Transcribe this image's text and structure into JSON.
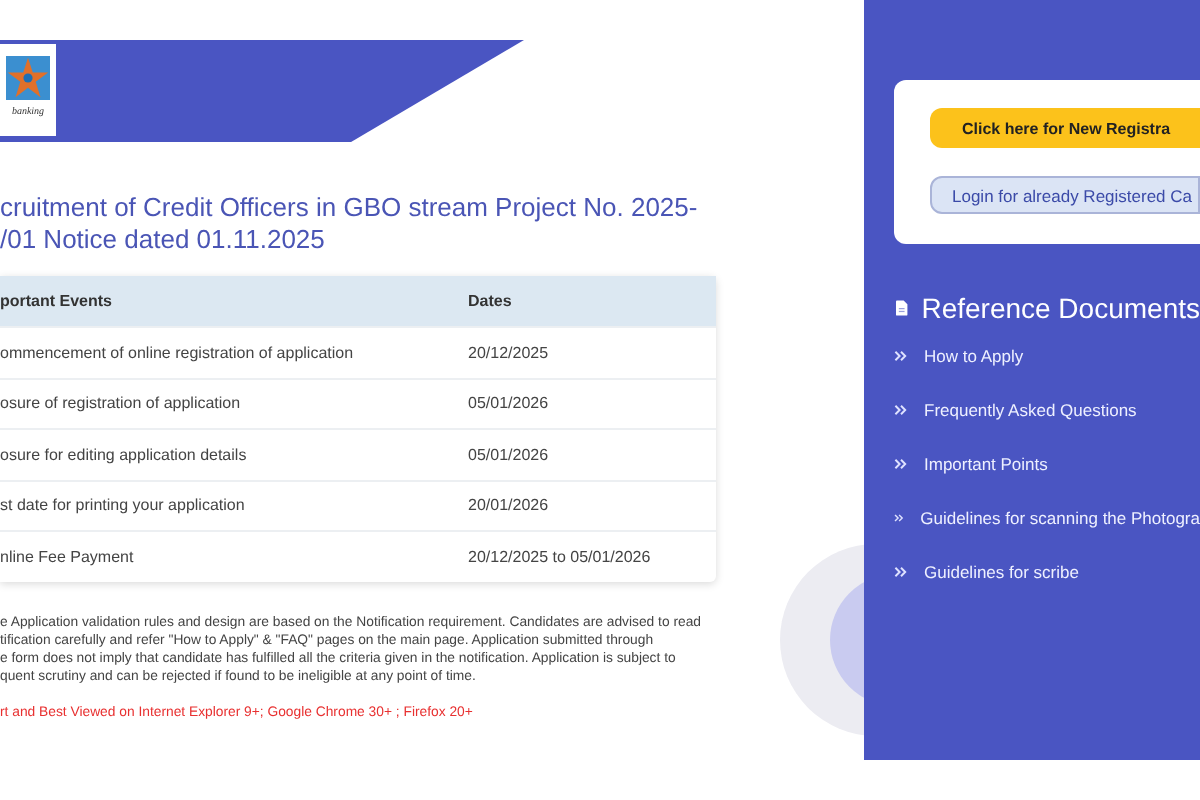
{
  "header": {
    "logo_text": "banking"
  },
  "notice": {
    "title_lines": [
      "cruitment of Credit Officers in GBO stream Project No. 2025-",
      "/01 Notice dated 01.11.2025"
    ],
    "table": {
      "columns": [
        "portant Events",
        "Dates"
      ],
      "rows": [
        [
          "ommencement of online registration of application",
          "20/12/2025"
        ],
        [
          "osure of registration of application",
          "05/01/2026"
        ],
        [
          "osure for editing application details",
          "05/01/2026"
        ],
        [
          "st date for printing your application",
          "20/01/2026"
        ],
        [
          "nline Fee Payment",
          "20/12/2025 to 05/01/2026"
        ]
      ]
    },
    "note_lines": [
      "e Application validation rules and design are based on the Notification requirement. Candidates are advised to read",
      "tification carefully and refer \"How to Apply\" & \"FAQ\" pages on the main page. Application submitted through",
      "e form does not imply that candidate has fulfilled all the criteria given in the notification. Application is subject to",
      "quent scrutiny and can be rejected if found to be ineligible at any point of time."
    ],
    "browser_note": "rt and Best Viewed on Internet Explorer 9+; Google Chrome 30+ ; Firefox 20+"
  },
  "sidebar": {
    "buttons": [
      {
        "kind": "primary",
        "label": "Click here for New Registra"
      },
      {
        "kind": "secondary",
        "label": "Login for already Registered Ca"
      }
    ],
    "reference_title": "Reference Documents",
    "links": [
      "How to Apply",
      "Frequently Asked Questions",
      "Important Points",
      "Guidelines for scanning the Photogra",
      "Guidelines for scribe"
    ]
  }
}
